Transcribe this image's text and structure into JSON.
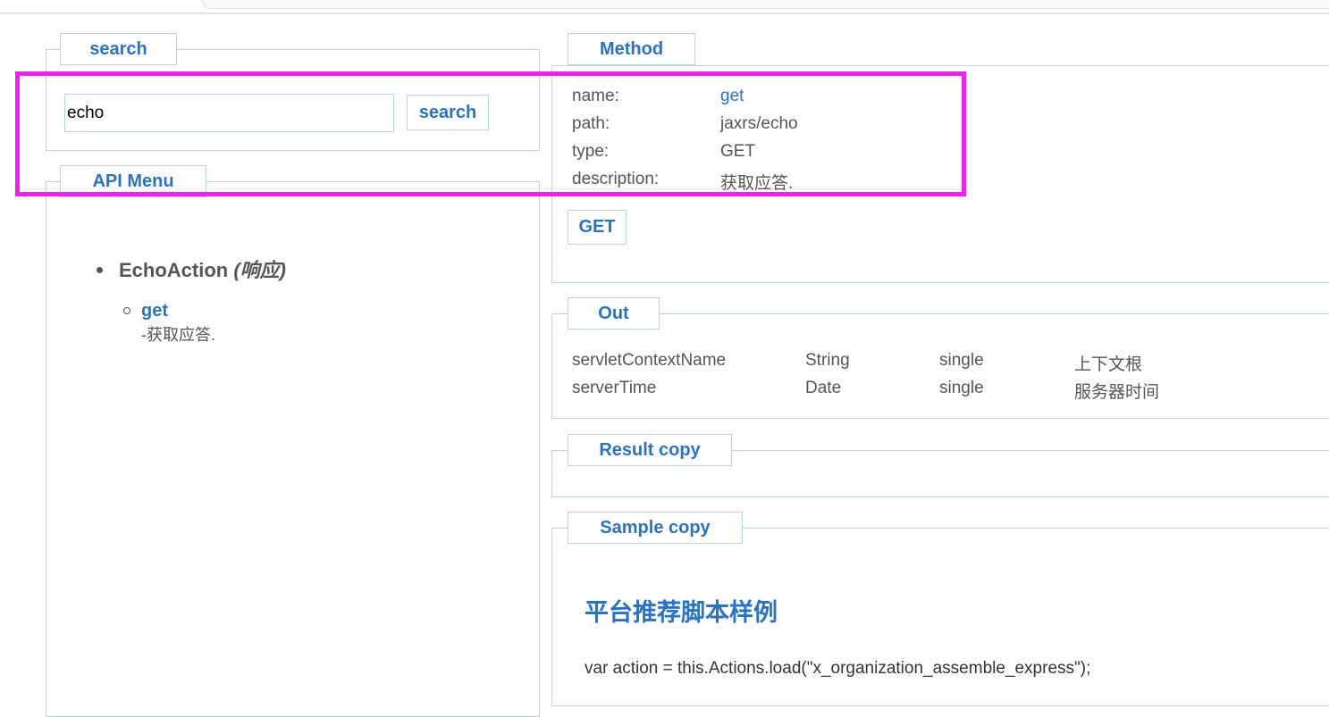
{
  "search": {
    "legend": "search",
    "input_value": "echo",
    "button_label": "search"
  },
  "api_menu": {
    "legend": "API Menu",
    "classes": [
      {
        "name": "EchoAction",
        "cn_name": "(响应)",
        "methods": [
          {
            "name": "get",
            "description": "-获取应答."
          }
        ]
      }
    ]
  },
  "method": {
    "legend": "Method",
    "rows": [
      {
        "key": "name:",
        "value": "get"
      },
      {
        "key": "path:",
        "value": "jaxrs/echo"
      },
      {
        "key": "type:",
        "value": "GET"
      },
      {
        "key": "description:",
        "value": "获取应答."
      }
    ],
    "action_button": "GET"
  },
  "out": {
    "legend": "Out",
    "rows": [
      {
        "field": "servletContextName",
        "type": "String",
        "multiplicity": "single",
        "desc": "上下文根"
      },
      {
        "field": "serverTime",
        "type": "Date",
        "multiplicity": "single",
        "desc": "服务器时间"
      }
    ]
  },
  "result": {
    "legend": "Result copy"
  },
  "sample": {
    "legend": "Sample copy",
    "title": "平台推荐脚本样例",
    "code_line": "var action = this.Actions.load(\"x_organization_assemble_express\");"
  },
  "colors": {
    "accent": "#2b73c2",
    "border": "#b8d3e8",
    "highlight": "#ee22ee",
    "text": "#555555"
  }
}
